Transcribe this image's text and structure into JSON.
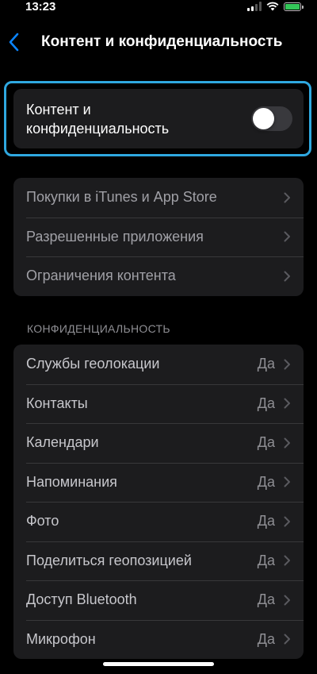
{
  "status_bar": {
    "time": "13:23"
  },
  "nav": {
    "back_icon": "chevron-left-icon",
    "title": "Контент и конфиденциальность"
  },
  "toggle": {
    "label": "Контент и конфиденциальность",
    "state": "off",
    "accent": "#2fa8e0"
  },
  "store_group": {
    "items": [
      {
        "label": "Покупки в iTunes и App Store"
      },
      {
        "label": "Разрешенные приложения"
      },
      {
        "label": "Ограничения контента"
      }
    ]
  },
  "privacy": {
    "header": "КОНФИДЕНЦИАЛЬНОСТЬ",
    "items": [
      {
        "label": "Службы геолокации",
        "value": "Да"
      },
      {
        "label": "Контакты",
        "value": "Да"
      },
      {
        "label": "Календари",
        "value": "Да"
      },
      {
        "label": "Напоминания",
        "value": "Да"
      },
      {
        "label": "Фото",
        "value": "Да"
      },
      {
        "label": "Поделиться геопозицией",
        "value": "Да"
      },
      {
        "label": "Доступ Bluetooth",
        "value": "Да"
      },
      {
        "label": "Микрофон",
        "value": "Да"
      }
    ]
  }
}
